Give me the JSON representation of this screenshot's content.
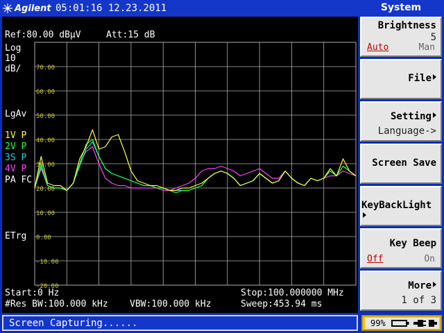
{
  "header": {
    "brand": "Agilent",
    "datetime": "05:01:16 12.23.2011"
  },
  "ref_line": {
    "ref": "Ref:80.00 dBµV",
    "att": "Att:15 dB"
  },
  "left_labels": {
    "scale_type": "Log",
    "scale_value": "10",
    "scale_unit": "dB/",
    "avg": "LgAv",
    "trace1": "1V P",
    "trace2": "2V P",
    "trace3": "3S P",
    "trace4": "4V P",
    "pa_fc": "PA FC",
    "trigger": "ETrg"
  },
  "footer": {
    "start": "Start:0 Hz",
    "stop": "Stop:100.000000 MHz",
    "rbw": "#Res BW:100.000 kHz",
    "vbw": "VBW:100.000 kHz",
    "sweep": "Sweep:453.94 ms"
  },
  "menu": {
    "title": "System",
    "brightness": {
      "label": "Brightness",
      "value": "5",
      "opt_auto": "Auto",
      "opt_man": "Man"
    },
    "file": {
      "label": "File"
    },
    "setting": {
      "label": "Setting",
      "sub": "Language->"
    },
    "screen_save": {
      "label": "Screen Save"
    },
    "keybacklight": {
      "label": "KeyBackLight"
    },
    "key_beep": {
      "label": "Key Beep",
      "opt_off": "Off",
      "opt_on": "On"
    },
    "more": {
      "label": "More",
      "page": "1 of 3"
    }
  },
  "status": {
    "message": "Screen Capturing......",
    "battery": "99%"
  },
  "colors": {
    "trace1": "#ffff33",
    "trace2": "#22ff44",
    "trace3": "#22d0e0",
    "trace4": "#ff44ff",
    "grid": "#b0b0b0",
    "tick_labels": "#cccc33"
  },
  "chart_data": {
    "type": "line",
    "x_unit": "MHz",
    "y_unit": "dBµV",
    "xlim": [
      0,
      100
    ],
    "ylim": [
      -20,
      80
    ],
    "y_ticks": [
      "70.00",
      "60.00",
      "50.00",
      "40.00",
      "30.00",
      "20.00",
      "10.00",
      "0.00",
      "-10.00",
      "-20.00"
    ],
    "series": [
      {
        "name": "1V P",
        "color": "#ffff33",
        "x": [
          0,
          2,
          4,
          6,
          8,
          10,
          12,
          14,
          16,
          18,
          20,
          22,
          24,
          26,
          28,
          30,
          32,
          34,
          36,
          38,
          40,
          42,
          44,
          46,
          48,
          50,
          52,
          54,
          56,
          58,
          60,
          62,
          64,
          66,
          68,
          70,
          72,
          74,
          76,
          78,
          80,
          82,
          84,
          86,
          88,
          90,
          92,
          94,
          96,
          98,
          100
        ],
        "y": [
          20,
          33,
          22,
          21,
          21,
          19,
          22,
          32,
          37,
          44,
          36,
          37,
          41,
          42,
          35,
          27,
          23,
          22,
          21,
          21,
          20,
          19,
          19,
          20,
          20,
          21,
          22,
          24,
          26,
          27,
          26,
          24,
          21,
          22,
          23,
          26,
          24,
          22,
          23,
          27,
          24,
          22,
          21,
          24,
          23,
          24,
          28,
          25,
          32,
          27,
          25
        ]
      },
      {
        "name": "2V P",
        "color": "#22ff44",
        "x": [
          0,
          2,
          4,
          6,
          8,
          10,
          12,
          14,
          16,
          18,
          20,
          22,
          24,
          26,
          28,
          30,
          32,
          34,
          36,
          38,
          40,
          42,
          44,
          46,
          48,
          50,
          52,
          54,
          56,
          58,
          60,
          62,
          64,
          66,
          68,
          70,
          72,
          74,
          76,
          78,
          80,
          82,
          84,
          86,
          88,
          90,
          92,
          94,
          96,
          98,
          100
        ],
        "y": [
          20,
          30,
          21,
          20,
          20,
          19,
          22,
          30,
          38,
          40,
          33,
          28,
          26,
          25,
          24,
          23,
          22,
          21,
          21,
          20,
          20,
          19,
          18,
          19,
          19,
          20,
          21,
          24,
          26,
          27,
          26,
          24,
          21,
          22,
          23,
          26,
          24,
          22,
          23,
          27,
          24,
          22,
          21,
          24,
          23,
          24,
          27,
          25,
          29,
          27,
          25
        ]
      },
      {
        "name": "3S P",
        "color": "#22d0e0",
        "x": [
          0,
          2,
          4,
          6,
          8,
          10,
          12,
          14,
          16,
          18,
          20,
          22,
          24,
          26,
          28,
          30,
          32,
          34,
          36,
          38,
          40,
          42,
          44,
          46,
          48,
          50,
          52,
          54,
          56,
          58,
          60,
          62,
          64,
          66,
          68,
          70,
          72,
          74,
          76,
          78,
          80,
          82,
          84,
          86,
          88,
          90,
          92,
          94,
          96,
          98,
          100
        ],
        "y": [
          20,
          29,
          21,
          20,
          20,
          19,
          22,
          29,
          36,
          39,
          33,
          28,
          26,
          25,
          24,
          23,
          22,
          21,
          21,
          20,
          20,
          19,
          19,
          19,
          19,
          20,
          21,
          24,
          26,
          27,
          26,
          24,
          21,
          22,
          23,
          26,
          24,
          22,
          23,
          27,
          24,
          22,
          21,
          24,
          23,
          24,
          27,
          25,
          29,
          27,
          25
        ]
      },
      {
        "name": "4V P",
        "color": "#ff44ff",
        "x": [
          0,
          2,
          4,
          6,
          8,
          10,
          12,
          14,
          16,
          18,
          20,
          22,
          24,
          26,
          28,
          30,
          32,
          34,
          36,
          38,
          40,
          42,
          44,
          46,
          48,
          50,
          52,
          54,
          56,
          58,
          60,
          62,
          64,
          66,
          68,
          70,
          72,
          74,
          76,
          78,
          80,
          82,
          84,
          86,
          88,
          90,
          92,
          94,
          96,
          98,
          100
        ],
        "y": [
          20,
          28,
          21,
          20,
          20,
          19,
          22,
          30,
          35,
          37,
          30,
          24,
          22,
          21,
          21,
          20,
          20,
          20,
          20,
          20,
          19,
          19,
          20,
          21,
          22,
          24,
          27,
          28,
          28,
          29,
          28,
          27,
          25,
          26,
          27,
          28,
          26,
          24,
          24,
          27,
          24,
          22,
          21,
          24,
          23,
          24,
          25,
          25,
          27,
          26,
          25
        ]
      }
    ]
  }
}
